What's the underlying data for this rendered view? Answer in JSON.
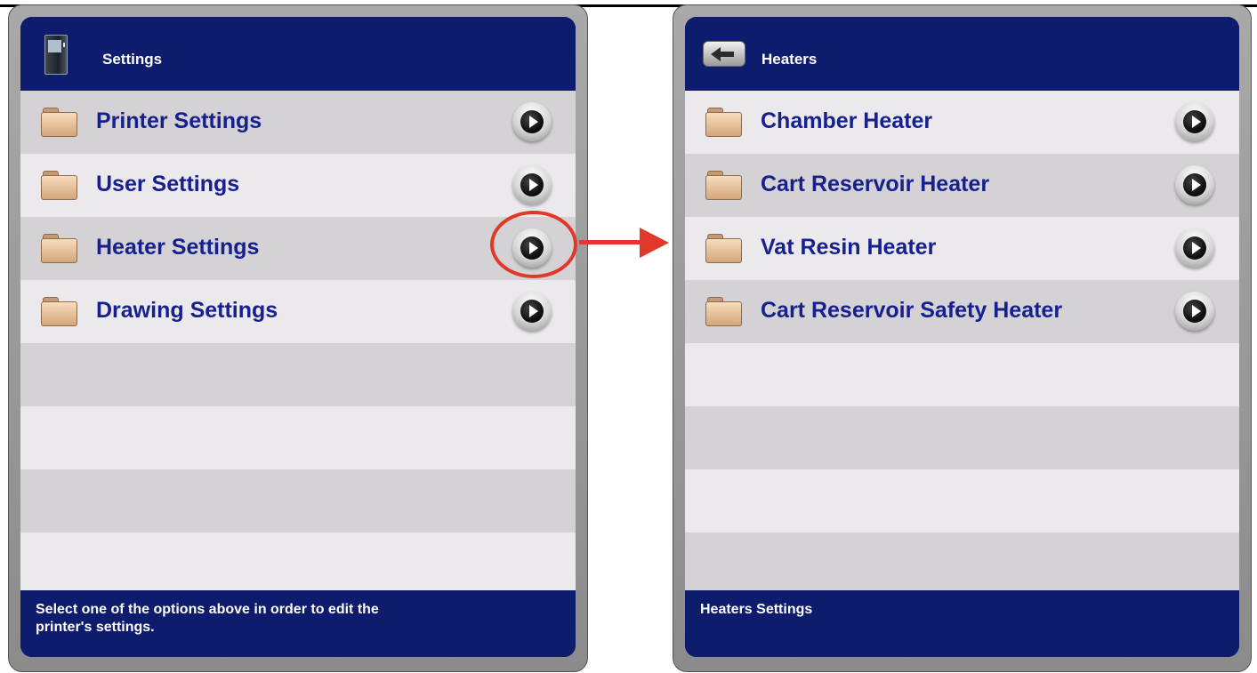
{
  "left_screen": {
    "title": "Settings",
    "items": [
      {
        "label": "Printer Settings"
      },
      {
        "label": "User Settings"
      },
      {
        "label": "Heater Settings"
      },
      {
        "label": "Drawing Settings"
      }
    ],
    "footer": "Select one of the options above in order to edit the printer's settings."
  },
  "right_screen": {
    "title": "Heaters",
    "items": [
      {
        "label": "Chamber Heater"
      },
      {
        "label": "Cart Reservoir Heater"
      },
      {
        "label": "Vat Resin Heater"
      },
      {
        "label": "Cart Reservoir Safety Heater"
      }
    ],
    "footer": "Heaters Settings"
  },
  "annotation": {
    "highlighted_item": "Heater Settings",
    "color": "#e0392a"
  },
  "colors": {
    "header": "#0e1c6e",
    "label_text": "#16208f",
    "row_dark": "#d5d2d5",
    "row_light": "#ece9ec"
  },
  "icons": {
    "folder": "folder-icon",
    "item_arrow": "arrow-right-button-icon",
    "left_header": "printer-device-icon",
    "right_header": "back-arrow-icon"
  }
}
